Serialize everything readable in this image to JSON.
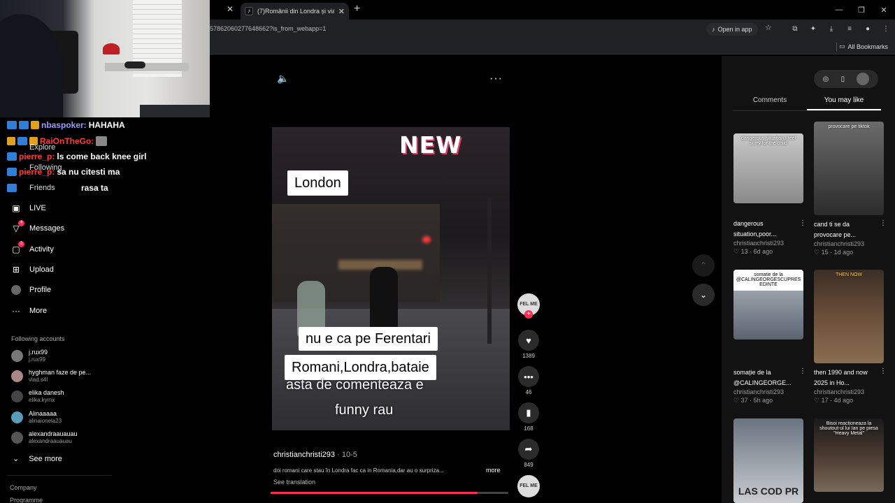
{
  "browser": {
    "tab_title": "(7)Românii din Londra și viața d",
    "url": "57862060277648662?is_from_webapp=1",
    "open_in_app": "Open in app",
    "all_bookmarks": "All Bookmarks"
  },
  "chat": [
    {
      "user": "nbaspoker:",
      "message": "HAHAHA"
    },
    {
      "user": "RaiOnTheGo:",
      "message": ""
    },
    {
      "user": "pierre_p:",
      "message": "ls come back knee girl"
    },
    {
      "user": "pierre_p:",
      "message": "sa nu citesti ma"
    },
    {
      "user": "",
      "message": "rasa ta"
    }
  ],
  "nav": {
    "explore": "Explore",
    "following": "Following",
    "friends": "Friends",
    "live": "LIVE",
    "messages": "Messages",
    "messages_badge": "4",
    "activity": "Activity",
    "activity_badge": "3",
    "upload": "Upload",
    "profile": "Profile",
    "more": "More",
    "following_accounts_title": "Following accounts",
    "see_more": "See more",
    "company": "Company",
    "programme": "Programme"
  },
  "following_accounts": [
    {
      "name": "j.rux99",
      "user": "j.rux99"
    },
    {
      "name": "hyghman faze de pe...",
      "user": "vlad.s4l"
    },
    {
      "name": "elika danesh",
      "user": "elika.kymx"
    },
    {
      "name": "Alinaaaaa",
      "user": "alinaionela23"
    },
    {
      "name": "alexandraauauau",
      "user": "alexandraauauau"
    }
  ],
  "video": {
    "overlay_new": "NEW",
    "overlay_london": "London",
    "overlay_ferentari": "nu e ca pe Ferentari",
    "overlay_romani": "Romani,Londra,bataie",
    "overlay_caption1": "asta de comenteaza e",
    "overlay_caption2": "funny rau",
    "username": "christianchristi293",
    "date": " · 10-5",
    "description": "doi romani care stau în Londra fac ca in Romania,dar au o surpriza...",
    "more": "more",
    "see_translation": "See translation",
    "progress": 0.87
  },
  "actions": {
    "avatar_text": "FEL ME",
    "likes": "1389",
    "comments": "46",
    "saves": "168",
    "shares": "849"
  },
  "right_panel": {
    "tab_comments": "Comments",
    "tab_you_may_like": "You may like",
    "cards": [
      {
        "thumb_text": "dangerous situation,I feel sorry for the child",
        "title": "dangerous situation,poor...",
        "user": "christianchristi293",
        "stat": "13 · 6d ago"
      },
      {
        "thumb_text": "provocare pe tiktok",
        "title": "cand ti se da provocare pe...",
        "user": "christianchristi293",
        "stat": "15 · 1d ago"
      },
      {
        "thumb_text": "somatie de la @CALINGEORGESCUPRES EDINTE",
        "title": "somație de la @CALINGEORGE...",
        "user": "christianchristi293",
        "stat": "37 · 5h ago"
      },
      {
        "thumb_text": "THEN NOW",
        "title": "then 1990 and now 2025 in Ho...",
        "user": "christianchristi293",
        "stat": "17 · 4d ago"
      },
      {
        "thumb_text": "LAS COD PR",
        "title": "",
        "user": "",
        "stat": ""
      },
      {
        "thumb_text": "Bisoi reactioneaza la shoutout-ul lui Ian pe piesa \"Heavy Metal\"",
        "title": "",
        "user": "",
        "stat": ""
      }
    ]
  }
}
